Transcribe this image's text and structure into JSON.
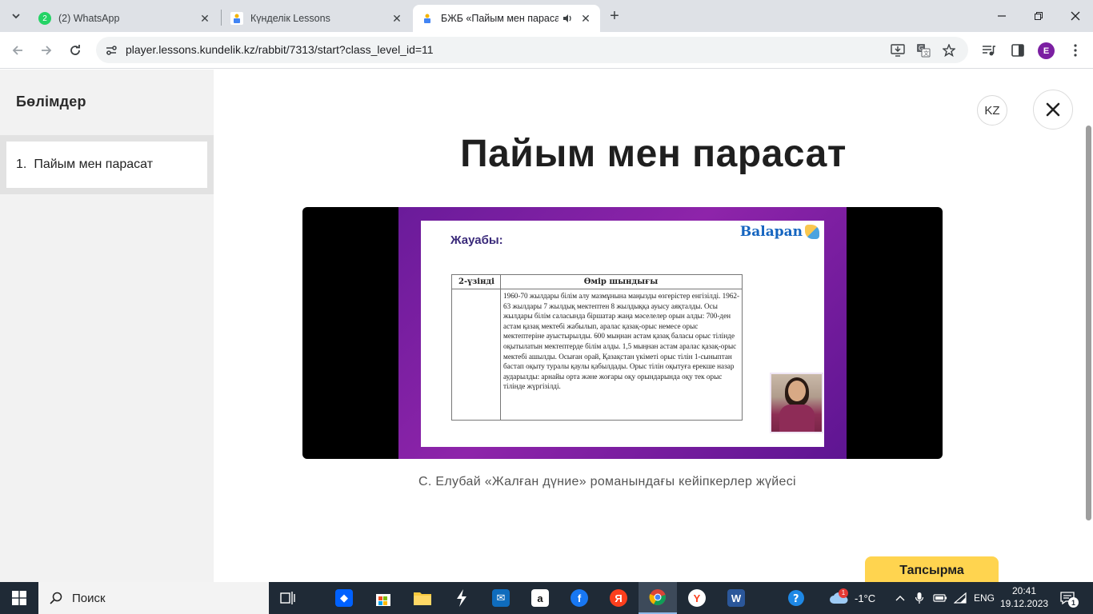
{
  "browser": {
    "tabs": [
      {
        "title": "(2) WhatsApp",
        "badge": "2"
      },
      {
        "title": "Күнделік Lessons"
      },
      {
        "title": "БЖБ «Пайым мен парасат»"
      }
    ],
    "url": "player.lessons.kundelik.kz/rabbit/7313/start?class_level_id=11",
    "profile_initial": "E"
  },
  "sidebar": {
    "title": "Бөлімдер",
    "items": [
      {
        "number": "1.",
        "label": "Пайым мен парасат"
      }
    ]
  },
  "header": {
    "lang_label": "KZ"
  },
  "lesson": {
    "title": "Пайым мен парасат",
    "slide": {
      "heading": "Жауабы:",
      "logo": "Balapan",
      "table_header_1": "2-үзінді",
      "table_header_2": "Өмір шындығы",
      "table_text": "1960-70 жылдары білім алу мазмұнына маңызды өзгерістер енгізілді. 1962-63 жылдары 7 жылдық мектептен 8 жылдыққа ауысу аяқталды. Осы жылдары білім саласында біршатар жаңа мәселелер орын алды: 700-ден астам қазақ мектебі жабылып, аралас қазақ-орыс немесе орыс мектептеріне ауыстырылды. 600 мыңнан астам қазақ баласы орыс тілінде оқытылатын мектептерде білім алды. 1,5 мыңнан астам аралас қазақ-орыс мектебі ашылды. Осыған орай, Қазақстан үкіметі орыс тілін 1-сыныптан бастап оқыту туралы қаулы қабылдады. Орыс тілін оқытуға ерекше назар аударылды: арнайы орта және жоғары оқу орындарында оқу тек орыс тілінде жүргізілді."
    },
    "caption": "С. Елубай «Жалған дүние» романындағы кейіпкерлер жүйесі",
    "task_button": "Тапсырма"
  },
  "taskbar": {
    "search_text": "Поиск",
    "weather": "-1°C",
    "weather_badge": "1",
    "language": "ENG",
    "time": "20:41",
    "date": "19.12.2023",
    "notification_count": "1"
  }
}
